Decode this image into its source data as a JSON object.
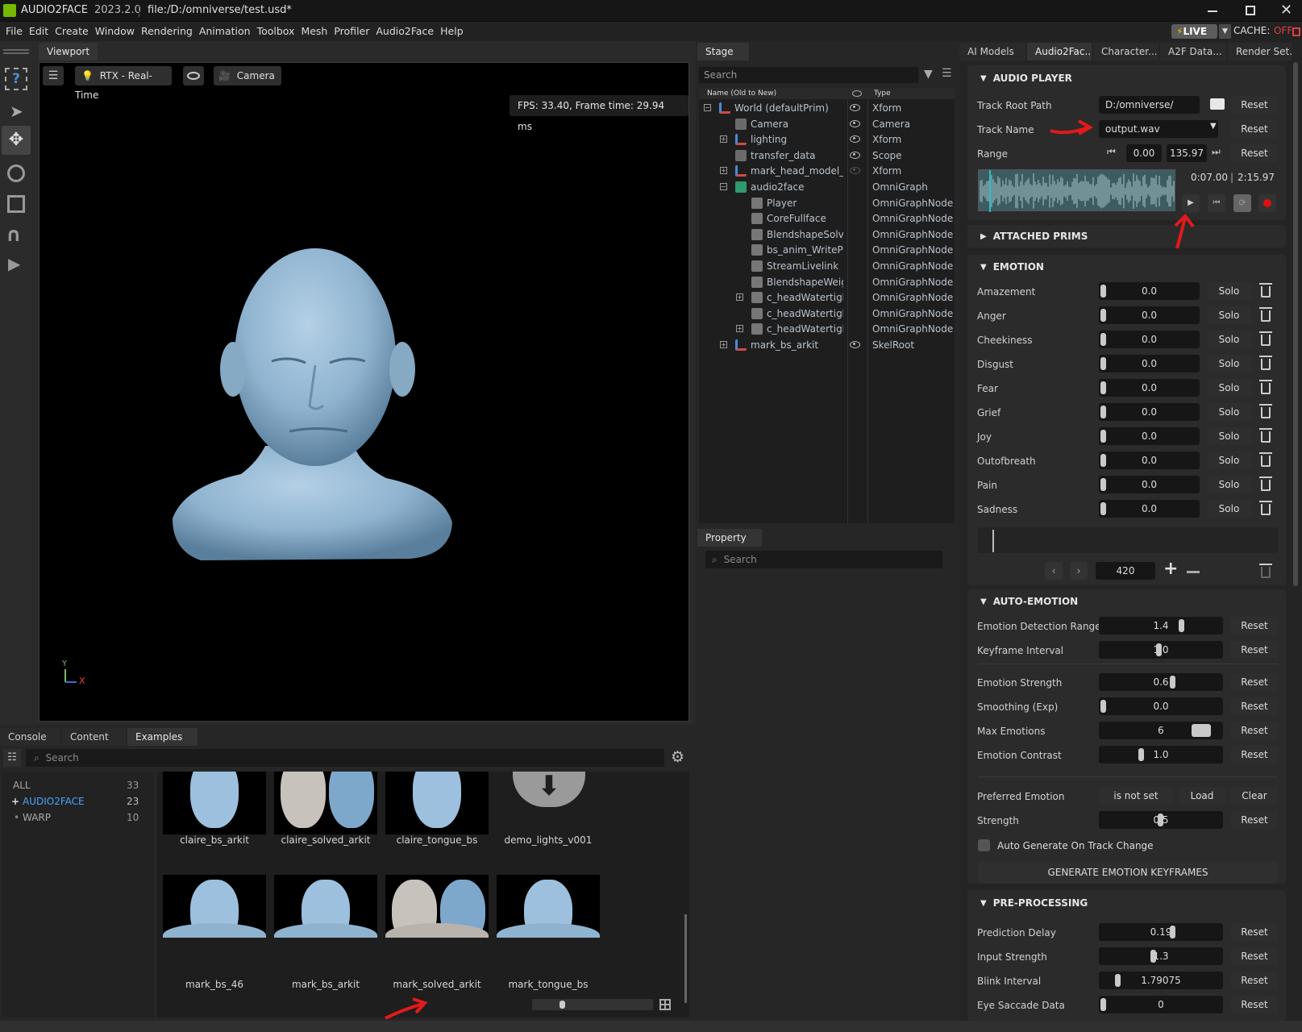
{
  "titlebar": {
    "app": "AUDIO2FACE",
    "version": "2023.2.0",
    "file": "file:/D:/omniverse/test.usd*"
  },
  "menu": [
    "File",
    "Edit",
    "Create",
    "Window",
    "Rendering",
    "Animation",
    "Toolbox",
    "Mesh",
    "Profiler",
    "Audio2Face",
    "Help"
  ],
  "menu_right": {
    "live": "LIVE",
    "cache": "CACHE:",
    "cache_state": "OFF"
  },
  "viewport": {
    "tab": "Viewport",
    "renderer": "RTX - Real-Time",
    "camera": "Camera",
    "fps": "FPS: 33.40, Frame time: 29.94 ms",
    "axis_y": "Y",
    "axis_x": "X"
  },
  "stage": {
    "tab": "Stage",
    "search_placeholder": "Search",
    "col_name": "Name (Old to New)",
    "col_type": "Type",
    "rows": [
      {
        "name": "World (defaultPrim)",
        "type": "Xform"
      },
      {
        "name": "Camera",
        "type": "Camera"
      },
      {
        "name": "lighting",
        "type": "Xform"
      },
      {
        "name": "transfer_data",
        "type": "Scope"
      },
      {
        "name": "mark_head_model_hi_",
        "type": "Xform"
      },
      {
        "name": "audio2face",
        "type": "OmniGraph"
      },
      {
        "name": "Player",
        "type": "OmniGraphNode"
      },
      {
        "name": "CoreFullface",
        "type": "OmniGraphNode"
      },
      {
        "name": "BlendshapeSolve",
        "type": "OmniGraphNode"
      },
      {
        "name": "bs_anim_WritePrin",
        "type": "OmniGraphNode"
      },
      {
        "name": "StreamLivelink",
        "type": "OmniGraphNode"
      },
      {
        "name": "BlendshapeWeigh",
        "type": "OmniGraphNode"
      },
      {
        "name": "c_headWatertight_",
        "type": "OmniGraphNode"
      },
      {
        "name": "c_headWatertight_",
        "type": "OmniGraphNode"
      },
      {
        "name": "c_headWatertight_",
        "type": "OmniGraphNode"
      },
      {
        "name": "mark_bs_arkit",
        "type": "SkelRoot"
      }
    ]
  },
  "property": {
    "tab": "Property",
    "search_placeholder": "Search"
  },
  "right_tabs": [
    "AI Models",
    "Audio2Fac...",
    "Character...",
    "A2F Data...",
    "Render Set..."
  ],
  "audio_player": {
    "title": "AUDIO PLAYER",
    "track_root_label": "Track Root Path",
    "track_root_value": "D:/omniverse/",
    "track_name_label": "Track Name",
    "track_name_value": "output.wav",
    "range_label": "Range",
    "range_start": "0.00",
    "range_end": "135.97",
    "time_current": "0:07.00",
    "time_sep": "|",
    "time_total": "2:15.97",
    "reset": "Reset"
  },
  "attached_prims": {
    "title": "ATTACHED PRIMS"
  },
  "emotion": {
    "title": "EMOTION",
    "solo": "Solo",
    "items": [
      {
        "label": "Amazement",
        "value": "0.0"
      },
      {
        "label": "Anger",
        "value": "0.0"
      },
      {
        "label": "Cheekiness",
        "value": "0.0"
      },
      {
        "label": "Disgust",
        "value": "0.0"
      },
      {
        "label": "Fear",
        "value": "0.0"
      },
      {
        "label": "Grief",
        "value": "0.0"
      },
      {
        "label": "Joy",
        "value": "0.0"
      },
      {
        "label": "Outofbreath",
        "value": "0.0"
      },
      {
        "label": "Pain",
        "value": "0.0"
      },
      {
        "label": "Sadness",
        "value": "0.0"
      }
    ],
    "frame": "420"
  },
  "auto_emotion": {
    "title": "AUTO-EMOTION",
    "reset": "Reset",
    "rows": [
      {
        "label": "Emotion Detection Range",
        "value": "1.4",
        "level": 0.68
      },
      {
        "label": "Keyframe Interval",
        "value": "1.0",
        "level": 0.48
      },
      {
        "label": "Emotion Strength",
        "value": "0.6",
        "level": 0.6
      },
      {
        "label": "Smoothing (Exp)",
        "value": "0.0",
        "level": 0.0
      },
      {
        "label": "Max Emotions",
        "value": "6",
        "level": 0.9
      },
      {
        "label": "Emotion Contrast",
        "value": "1.0",
        "level": 0.33
      }
    ],
    "preferred_label": "Preferred Emotion",
    "preferred_value": "is not set",
    "load": "Load",
    "clear": "Clear",
    "strength_label": "Strength",
    "strength_value": "0.5",
    "auto_generate_label": "Auto Generate On Track Change",
    "generate_button": "GENERATE EMOTION KEYFRAMES"
  },
  "pre_processing": {
    "title": "PRE-PROCESSING",
    "reset": "Reset",
    "rows": [
      {
        "label": "Prediction Delay",
        "value": "0.19"
      },
      {
        "label": "Input Strength",
        "value": "1.3"
      },
      {
        "label": "Blink Interval",
        "value": "1.79075"
      },
      {
        "label": "Eye Saccade Data",
        "value": "0"
      }
    ]
  },
  "bottom": {
    "tabs": [
      "Console",
      "Content",
      "Examples"
    ],
    "search_placeholder": "Search",
    "categories": [
      {
        "name": "ALL",
        "count": "33"
      },
      {
        "name": "AUDIO2FACE",
        "count": "23"
      },
      {
        "name": "WARP",
        "count": "10"
      }
    ],
    "examples": [
      "claire_bs_arkit",
      "claire_solved_arkit",
      "claire_tongue_bs",
      "demo_lights_v001",
      "mark_bs_46",
      "mark_bs_arkit",
      "mark_solved_arkit",
      "mark_tongue_bs"
    ]
  },
  "colors": {
    "accent_green": "#76b900",
    "live_yellow": "#d8b400",
    "cache_off": "#e04040",
    "annotation_red": "#e3191b",
    "head_blue": "#8fb3cf"
  }
}
